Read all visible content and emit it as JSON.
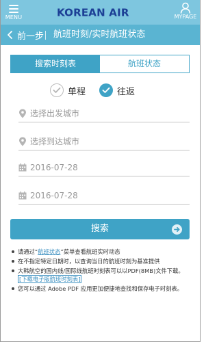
{
  "header": {
    "menu_label": "MENU",
    "brand_name": "KOREAN AIR",
    "mypage_label": "MYPAGE"
  },
  "subheader": {
    "back_label": "前一步",
    "title": "航班时刻/实时航班状态"
  },
  "tabs": [
    {
      "label": "搜索时刻表",
      "active": true
    },
    {
      "label": "航班状态",
      "active": false
    }
  ],
  "trip_type": {
    "one_way": "单程",
    "round_trip": "往返",
    "selected": "round_trip"
  },
  "form": {
    "departure_placeholder": "选择出发城市",
    "arrival_placeholder": "选择到达城市",
    "depart_date": "2016-07-28",
    "return_date": "2016-07-28"
  },
  "search_button": "搜索",
  "notes": {
    "n1_before": "请通过“",
    "n1_link": "航班状态",
    "n1_after": "”菜单查看航班实时动态",
    "n2": "在不指定特定日期时，以查询当日的航班时刻为基准提供",
    "n3_text": "大韩航空的国内线/国际线航班时刻表可以以PDF(8MB)文件下载。",
    "n3_link": "[下载电子版航班时刻表]",
    "n4": "您可以通过 Adobe PDF 应用更加便捷地查找和保存电子时刻表。"
  },
  "colors": {
    "header_bg": "#7ec6df",
    "subheader_bg": "#5ab4d2",
    "accent": "#3fa3c6",
    "brand_text": "#1c3f95"
  }
}
